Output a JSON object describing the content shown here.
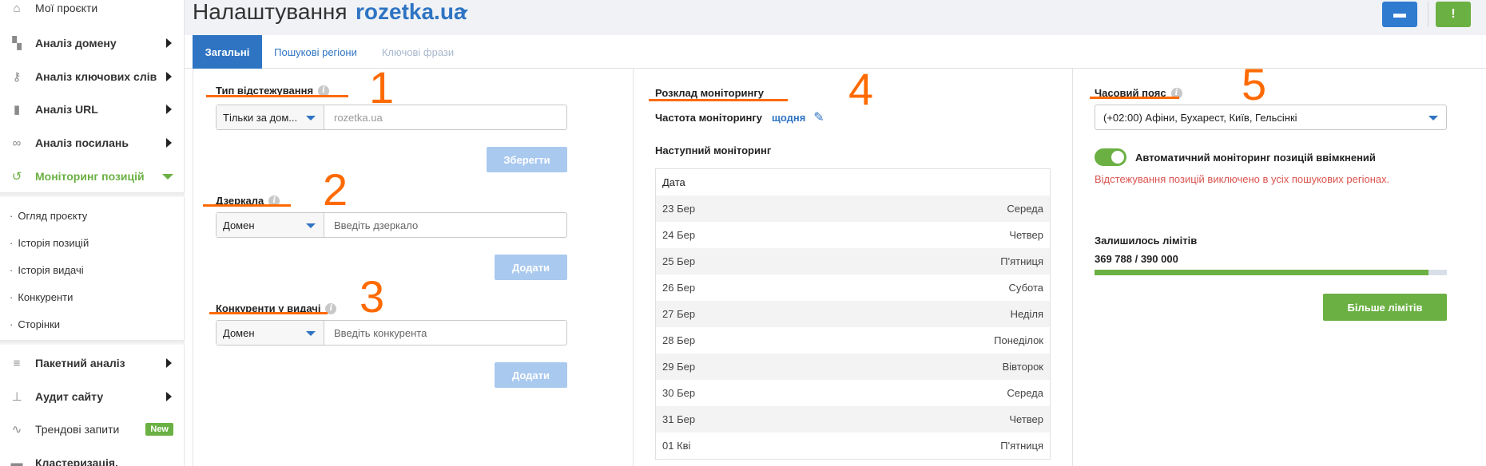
{
  "sidebar": {
    "my_projects": "Мої проєкти",
    "items": [
      {
        "label": "Аналіз домену"
      },
      {
        "label": "Аналіз ключових слів"
      },
      {
        "label": "Аналіз URL"
      },
      {
        "label": "Аналіз посилань"
      },
      {
        "label": "Моніторинг позицій"
      }
    ],
    "sub_items": [
      "Огляд проєкту",
      "Історія позицій",
      "Історія видачі",
      "Конкуренти",
      "Сторінки"
    ],
    "bottom_items": [
      {
        "label": "Пакетний аналіз"
      },
      {
        "label": "Аудит сайту"
      },
      {
        "label": "Трендові запити",
        "badge": "New"
      },
      {
        "label": "Кластеризація,"
      }
    ]
  },
  "header": {
    "title": "Налаштування",
    "project": "rozetka.ua"
  },
  "tabs": [
    "Загальні",
    "Пошукові регіони",
    "Ключові фрази"
  ],
  "tracking": {
    "label": "Тип відстежування",
    "mode": "Тільки за дом...",
    "value": "rozetka.ua",
    "save": "Зберегти",
    "annotation": "1"
  },
  "mirrors": {
    "label": "Дзеркала",
    "type": "Домен",
    "placeholder": "Введіть дзеркало",
    "add": "Додати",
    "annotation": "2"
  },
  "competitors": {
    "label": "Конкуренти у видачі",
    "type": "Домен",
    "placeholder": "Введіть конкурента",
    "add": "Додати",
    "annotation": "3"
  },
  "schedule": {
    "title": "Розклад моніторингу",
    "freq_label": "Частота моніторингу",
    "freq_value": "щодня",
    "next_label": "Наступний моніторинг",
    "col_date": "Дата",
    "rows": [
      {
        "date": "23 Бер",
        "day": "Середа"
      },
      {
        "date": "24 Бер",
        "day": "Четвер"
      },
      {
        "date": "25 Бер",
        "day": "П'ятниця"
      },
      {
        "date": "26 Бер",
        "day": "Субота"
      },
      {
        "date": "27 Бер",
        "day": "Неділя"
      },
      {
        "date": "28 Бер",
        "day": "Понеділок"
      },
      {
        "date": "29 Бер",
        "day": "Вівторок"
      },
      {
        "date": "30 Бер",
        "day": "Середа"
      },
      {
        "date": "31 Бер",
        "day": "Четвер"
      },
      {
        "date": "01 Кві",
        "day": "П'ятниця"
      }
    ],
    "annotation": "4"
  },
  "timezone": {
    "label": "Часовий пояс",
    "value": "(+02:00) Афіни, Бухарест, Київ, Гельсінкі",
    "annotation": "5"
  },
  "auto_monitor": {
    "label": "Автоматичний моніторинг позицій ввімкнений",
    "on": true,
    "warning": "Відстежування позицій виключено в усіх пошукових регіонах."
  },
  "limits": {
    "title": "Залишилось лімітів",
    "value": "369 788 / 390 000",
    "fraction": 0.948,
    "more": "Більше лімітів"
  },
  "colors": {
    "accent_blue": "#2e74c3",
    "accent_green": "#6bb043",
    "annotation_orange": "#ff6a00",
    "warning_red": "#d9534f"
  }
}
